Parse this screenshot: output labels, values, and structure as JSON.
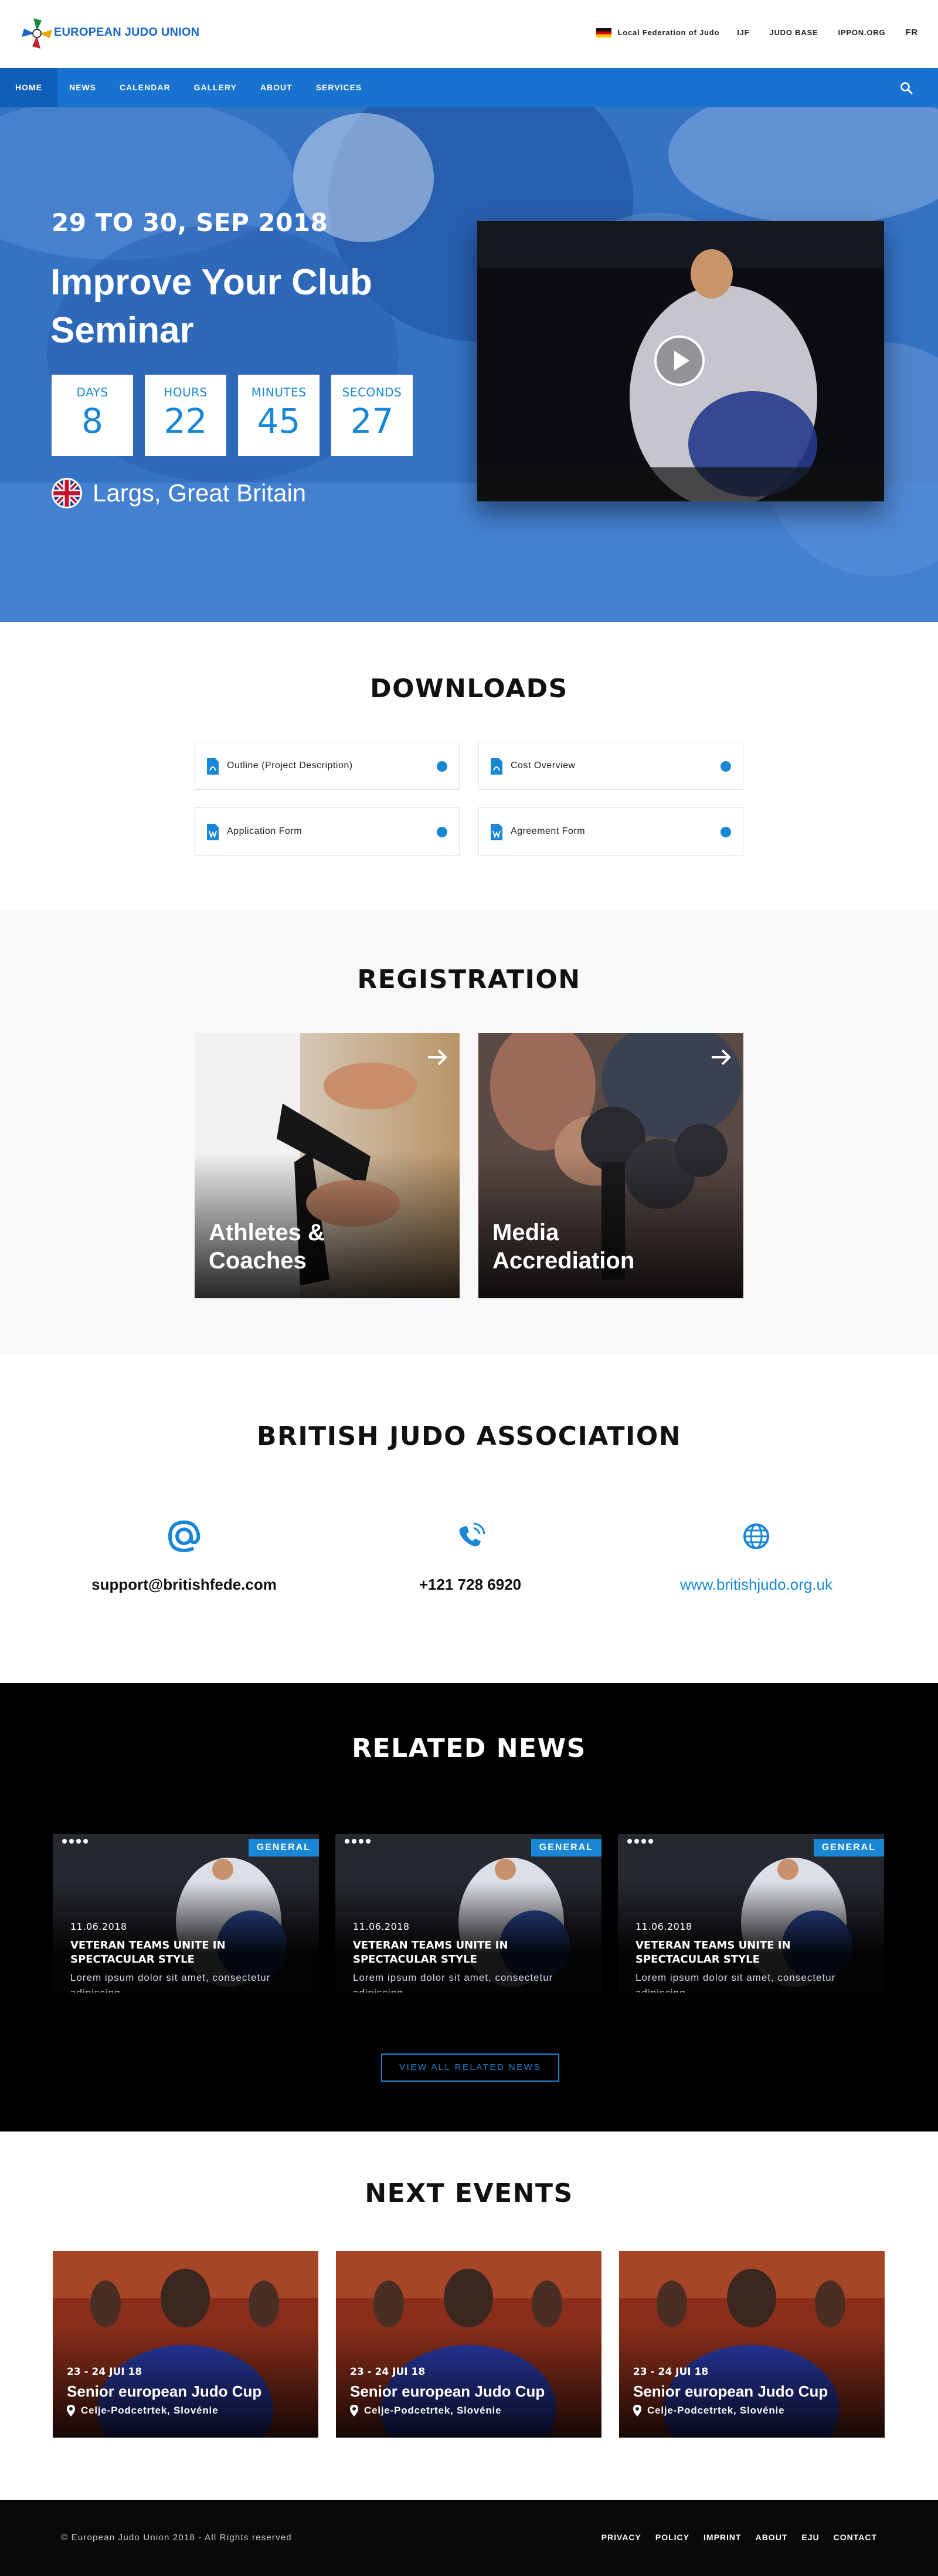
{
  "header": {
    "logo_text": "EUROPEAN JUDO UNION",
    "federation_link": "Local Federation of Judo",
    "links": [
      "IJF",
      "JUDO BASE",
      "IPPON.ORG"
    ],
    "language": "FR"
  },
  "nav": {
    "items": [
      "HOME",
      "NEWS",
      "CALENDAR",
      "GALLERY",
      "ABOUT",
      "SERVICES"
    ],
    "active": "HOME",
    "accent_color": "#1872cf"
  },
  "hero": {
    "date": "29 TO 30, SEP 2018",
    "title": "Improve Your Club Seminar",
    "countdown": [
      {
        "label": "DAYS",
        "value": "8"
      },
      {
        "label": "HOURS",
        "value": "22"
      },
      {
        "label": "MINUTES",
        "value": "45"
      },
      {
        "label": "SECONDS",
        "value": "27"
      }
    ],
    "location": "Largs, Great Britain",
    "video_icon": "play-icon"
  },
  "downloads": {
    "title": "DOWNLOADS",
    "items": [
      {
        "label": "Outline (Project Description)",
        "icon": "pdf-file-icon"
      },
      {
        "label": "Cost Overview",
        "icon": "pdf-file-icon"
      },
      {
        "label": "Application Form",
        "icon": "word-file-icon"
      },
      {
        "label": "Agreement Form",
        "icon": "word-file-icon"
      }
    ]
  },
  "registration": {
    "title": "REGISTRATION",
    "cards": [
      {
        "label": "Athletes & Coaches"
      },
      {
        "label": "Media Accrediation"
      }
    ]
  },
  "association": {
    "title": "BRITISH JUDO ASSOCIATION",
    "email": "support@britishfede.com",
    "phone": "+121 728 6920",
    "website": "www.britishjudo.org.uk"
  },
  "news": {
    "title": "RELATED NEWS",
    "cards": [
      {
        "badge": "GENERAL",
        "date": "11.06.2018",
        "title": "VETERAN TEAMS UNITE IN SPECTACULAR STYLE",
        "body": "Lorem ipsum dolor sit amet, consectetur adipiscing"
      },
      {
        "badge": "GENERAL",
        "date": "11.06.2018",
        "title": "VETERAN TEAMS UNITE IN SPECTACULAR STYLE",
        "body": "Lorem ipsum dolor sit amet, consectetur adipiscing"
      },
      {
        "badge": "GENERAL",
        "date": "11.06.2018",
        "title": "VETERAN TEAMS UNITE IN SPECTACULAR STYLE",
        "body": "Lorem ipsum dolor sit amet, consectetur adipiscing"
      }
    ],
    "view_all": "VIEW ALL RELATED NEWS"
  },
  "events": {
    "title": "NEXT EVENTS",
    "cards": [
      {
        "date": "23 - 24 JUI 18",
        "name": "Senior european Judo Cup",
        "place": "Celje-Podcetrtek, Slovénie"
      },
      {
        "date": "23 - 24 JUI 18",
        "name": "Senior european Judo Cup",
        "place": "Celje-Podcetrtek, Slovénie"
      },
      {
        "date": "23 - 24 JUI 18",
        "name": "Senior european Judo Cup",
        "place": "Celje-Podcetrtek, Slovénie"
      }
    ]
  },
  "footer": {
    "copyright": "© European Judo Union 2018 - All Rights reserved",
    "links": [
      "PRIVACY",
      "POLICY",
      "IMPRINT",
      "ABOUT",
      "EJU",
      "CONTACT"
    ]
  }
}
